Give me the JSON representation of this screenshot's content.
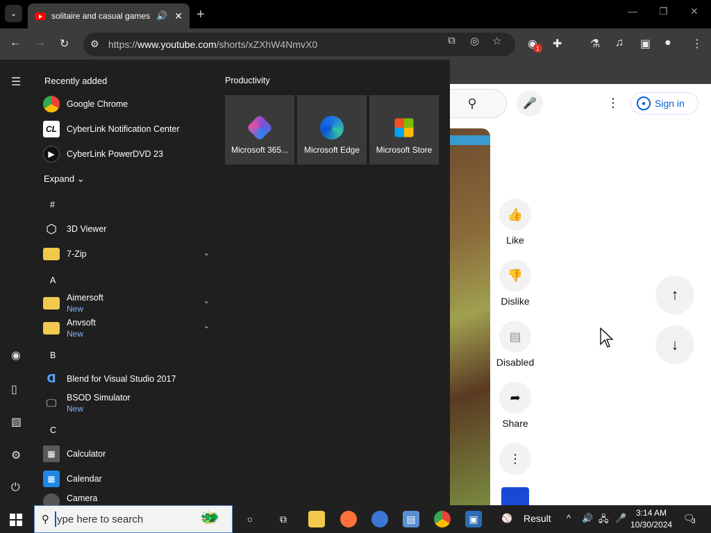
{
  "browser": {
    "tab_title": "solitaire and casual games",
    "url_prefix": "https://",
    "url_domain": "www.youtube.com",
    "url_path": "/shorts/xZXhW4NmvX0",
    "extension_badge": "1"
  },
  "youtube": {
    "sign_in_label": "Sign in",
    "actions": [
      {
        "label": "Like",
        "icon": "thumbs-up-icon"
      },
      {
        "label": "Dislike",
        "icon": "thumbs-down-icon"
      },
      {
        "label": "Disabled",
        "icon": "comment-icon"
      },
      {
        "label": "Share",
        "icon": "share-icon"
      }
    ]
  },
  "start_menu": {
    "recently_added_label": "Recently added",
    "expand_label": "Expand",
    "productivity_label": "Productivity",
    "recent": [
      "Google Chrome",
      "CyberLink Notification Center",
      "CyberLink PowerDVD 23"
    ],
    "letters": {
      "hash": "#",
      "a": "A",
      "b": "B",
      "c": "C"
    },
    "apps": {
      "viewer3d": "3D Viewer",
      "zip7": "7-Zip",
      "aimersoft": "Aimersoft",
      "anvsoft": "Anvsoft",
      "blend": "Blend for Visual Studio 2017",
      "bsod": "BSOD Simulator",
      "calculator": "Calculator",
      "calendar": "Calendar",
      "camera": "Camera"
    },
    "new_label": "New",
    "tiles": [
      "Microsoft 365...",
      "Microsoft Edge",
      "Microsoft Store"
    ]
  },
  "taskbar": {
    "search_placeholder": "ype here to search",
    "weather_label": "Result",
    "time": "3:14 AM",
    "date": "10/30/2024",
    "notification_count": "3"
  },
  "colors": {
    "accent": "#065fd4",
    "youtube_red": "#ff0000",
    "start_bg": "#1f1f1f",
    "new_text": "#8ab4f8"
  }
}
